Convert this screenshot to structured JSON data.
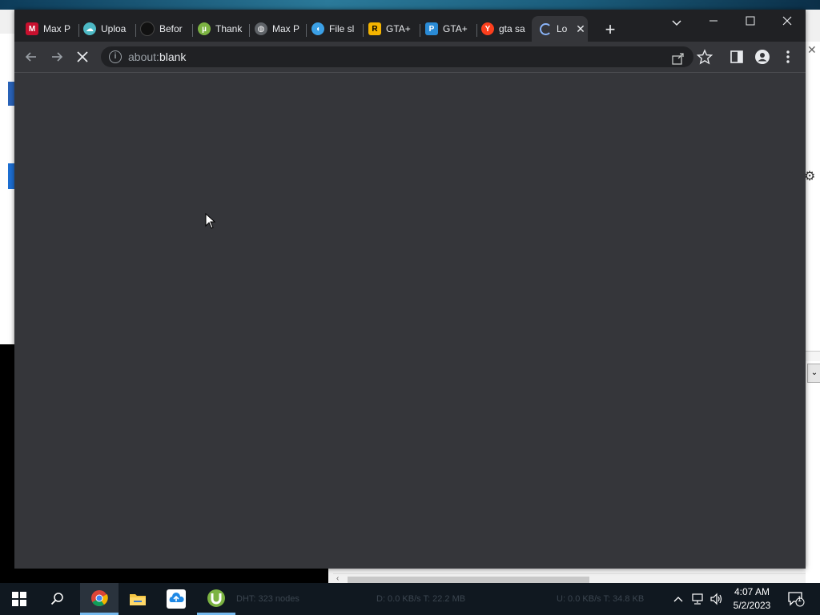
{
  "browser": {
    "tabs": [
      {
        "label": "Max P",
        "favicon": "mcafee-icon",
        "color": "#c8102e"
      },
      {
        "label": "Uploa",
        "favicon": "cloud-upload-icon",
        "color": "#4cb8c4"
      },
      {
        "label": "Befor",
        "favicon": "shield-dark-icon",
        "color": "#111111"
      },
      {
        "label": "Thank",
        "favicon": "utorrent-icon",
        "color": "#7cb342"
      },
      {
        "label": "Max P",
        "favicon": "globe-icon",
        "color": "#9aa0a6"
      },
      {
        "label": "File sl",
        "favicon": "fish-icon",
        "color": "#3ba0e6"
      },
      {
        "label": "GTA+",
        "favicon": "rockstar-icon",
        "color": "#f4b400"
      },
      {
        "label": "GTA+",
        "favicon": "playstation-icon",
        "color": "#2a8bd6"
      },
      {
        "label": "gta sa",
        "favicon": "yandex-icon",
        "color": "#fc3f1d"
      },
      {
        "label": "Lo",
        "favicon": "loading-spinner-icon",
        "color": "#9aa0a6"
      }
    ],
    "new_tab_symbol": "+",
    "url_prefix": "about:",
    "url_host": "blank"
  },
  "taskbar": {
    "dht_text": "DHT: 323 nodes",
    "download_text": "D: 0.0 KB/s T: 22.2 MB",
    "upload_text": "U: 0.0 KB/s T: 34.8 KB",
    "time": "4:07 AM",
    "date": "5/2/2023",
    "notification_count": "1"
  },
  "colors": {
    "accent": "#76b9ed",
    "browser_frame": "#202124",
    "browser_content": "#35363a"
  }
}
